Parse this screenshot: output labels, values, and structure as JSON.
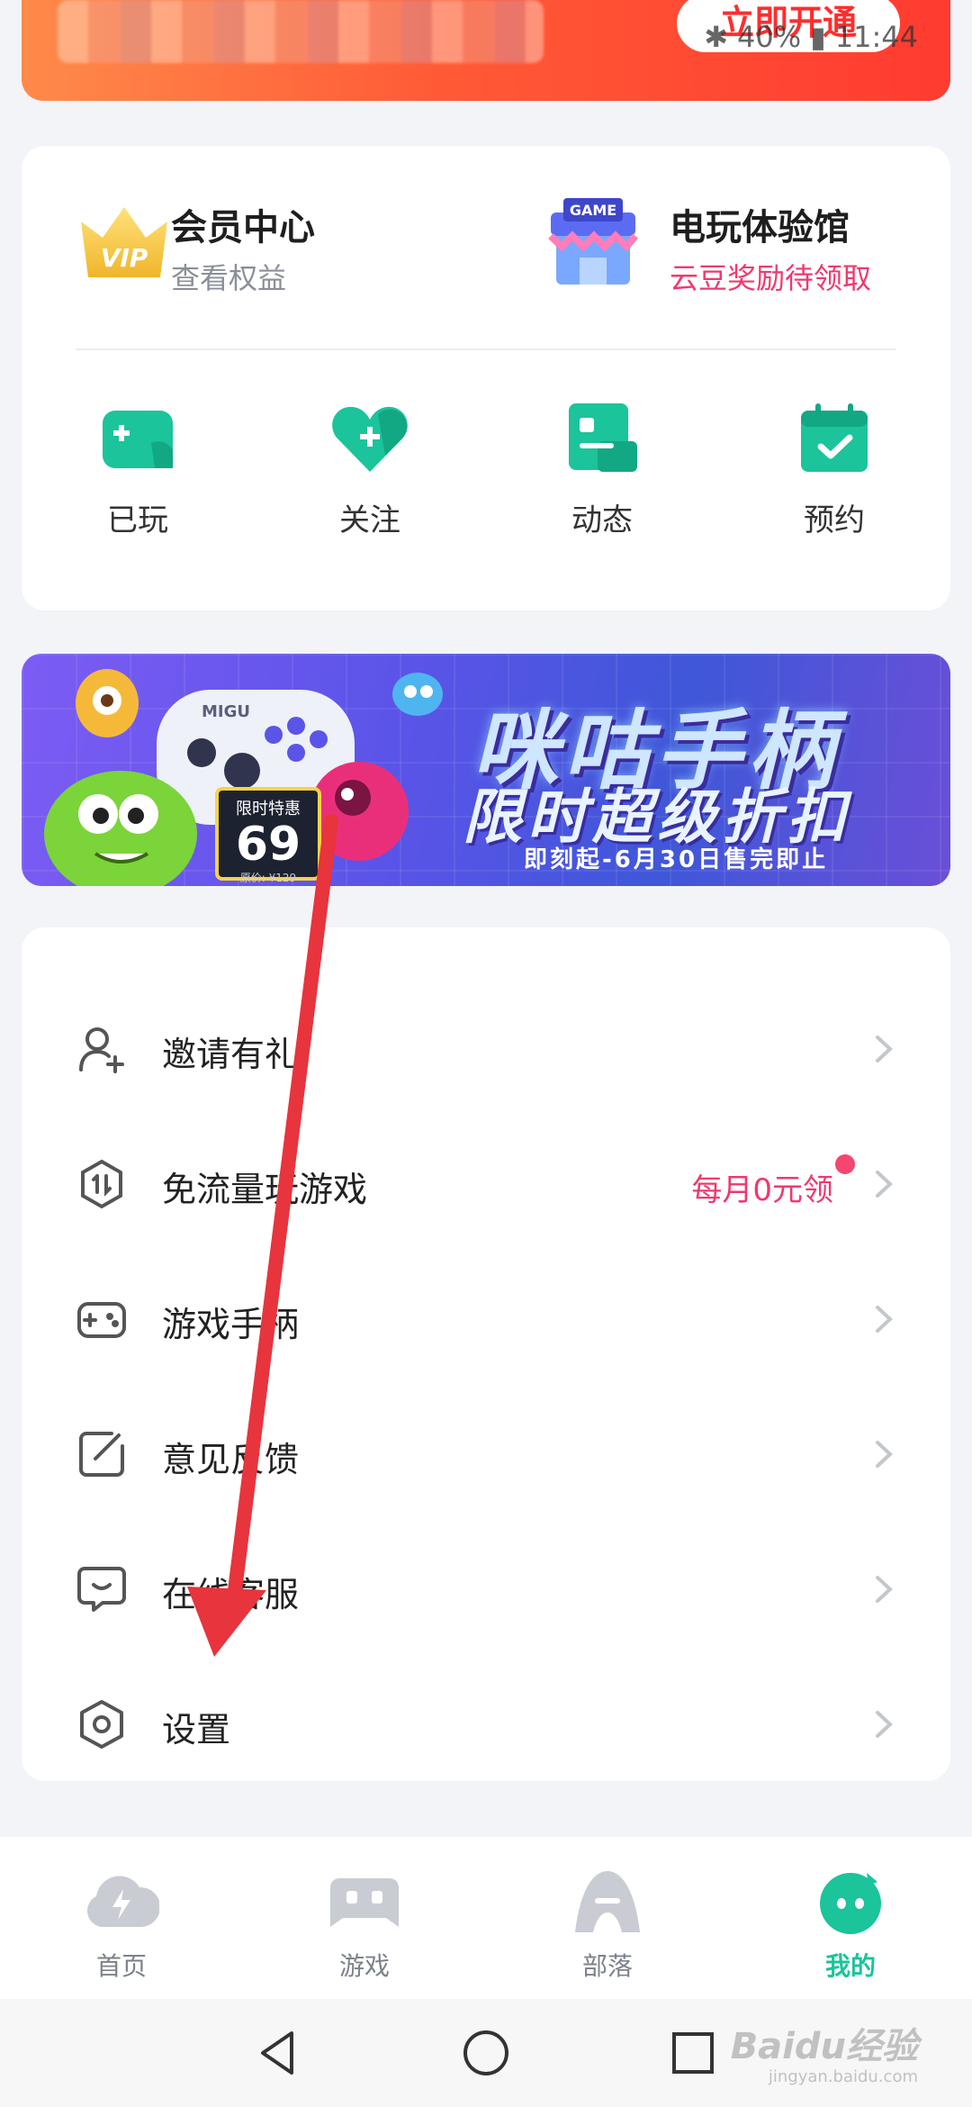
{
  "status_bar": {
    "battery": "40%",
    "time": "11:44"
  },
  "promo": {
    "open_button": "立即开通"
  },
  "member": {
    "vip_badge": "VIP",
    "vip_title": "会员中心",
    "vip_subtitle": "查看权益",
    "arcade_badge": "GAME",
    "arcade_title": "电玩体验馆",
    "arcade_subtitle": "云豆奖励待领取"
  },
  "quick_actions": [
    {
      "label": "已玩",
      "icon": "gamepad-icon"
    },
    {
      "label": "关注",
      "icon": "heart-plus-icon"
    },
    {
      "label": "动态",
      "icon": "card-icon"
    },
    {
      "label": "预约",
      "icon": "calendar-check-icon"
    }
  ],
  "ad_banner": {
    "line1": "咪咕手柄",
    "line2": "限时超级折扣",
    "line3": "即刻起-6月30日售完即止",
    "controller_brand": "MIGU",
    "price_tag_title": "限时特惠",
    "price_tag_value": "69",
    "price_tag_original": "原价: ¥129"
  },
  "menu": [
    {
      "label": "邀请有礼",
      "icon": "person-add-icon",
      "extra": ""
    },
    {
      "label": "免流量玩游戏",
      "icon": "data-free-icon",
      "extra": "每月0元领"
    },
    {
      "label": "游戏手柄",
      "icon": "controller-icon",
      "extra": ""
    },
    {
      "label": "意见反馈",
      "icon": "edit-icon",
      "extra": ""
    },
    {
      "label": "在线客服",
      "icon": "chat-icon",
      "extra": ""
    },
    {
      "label": "设置",
      "icon": "settings-icon",
      "extra": ""
    }
  ],
  "tabs": [
    {
      "label": "首页",
      "icon": "lightning-cloud-icon",
      "active": false
    },
    {
      "label": "游戏",
      "icon": "gamepad-icon",
      "active": false
    },
    {
      "label": "部落",
      "icon": "tribe-icon",
      "active": false
    },
    {
      "label": "我的",
      "icon": "mascot-icon",
      "active": true
    }
  ],
  "watermark": {
    "text": "Baidu经验",
    "sub": "jingyan.baidu.com"
  },
  "colors": {
    "accent": "#1bc49a",
    "pink": "#ee3a6e",
    "promo_red": "#ff3b30",
    "annotation_red": "#e8343c"
  }
}
